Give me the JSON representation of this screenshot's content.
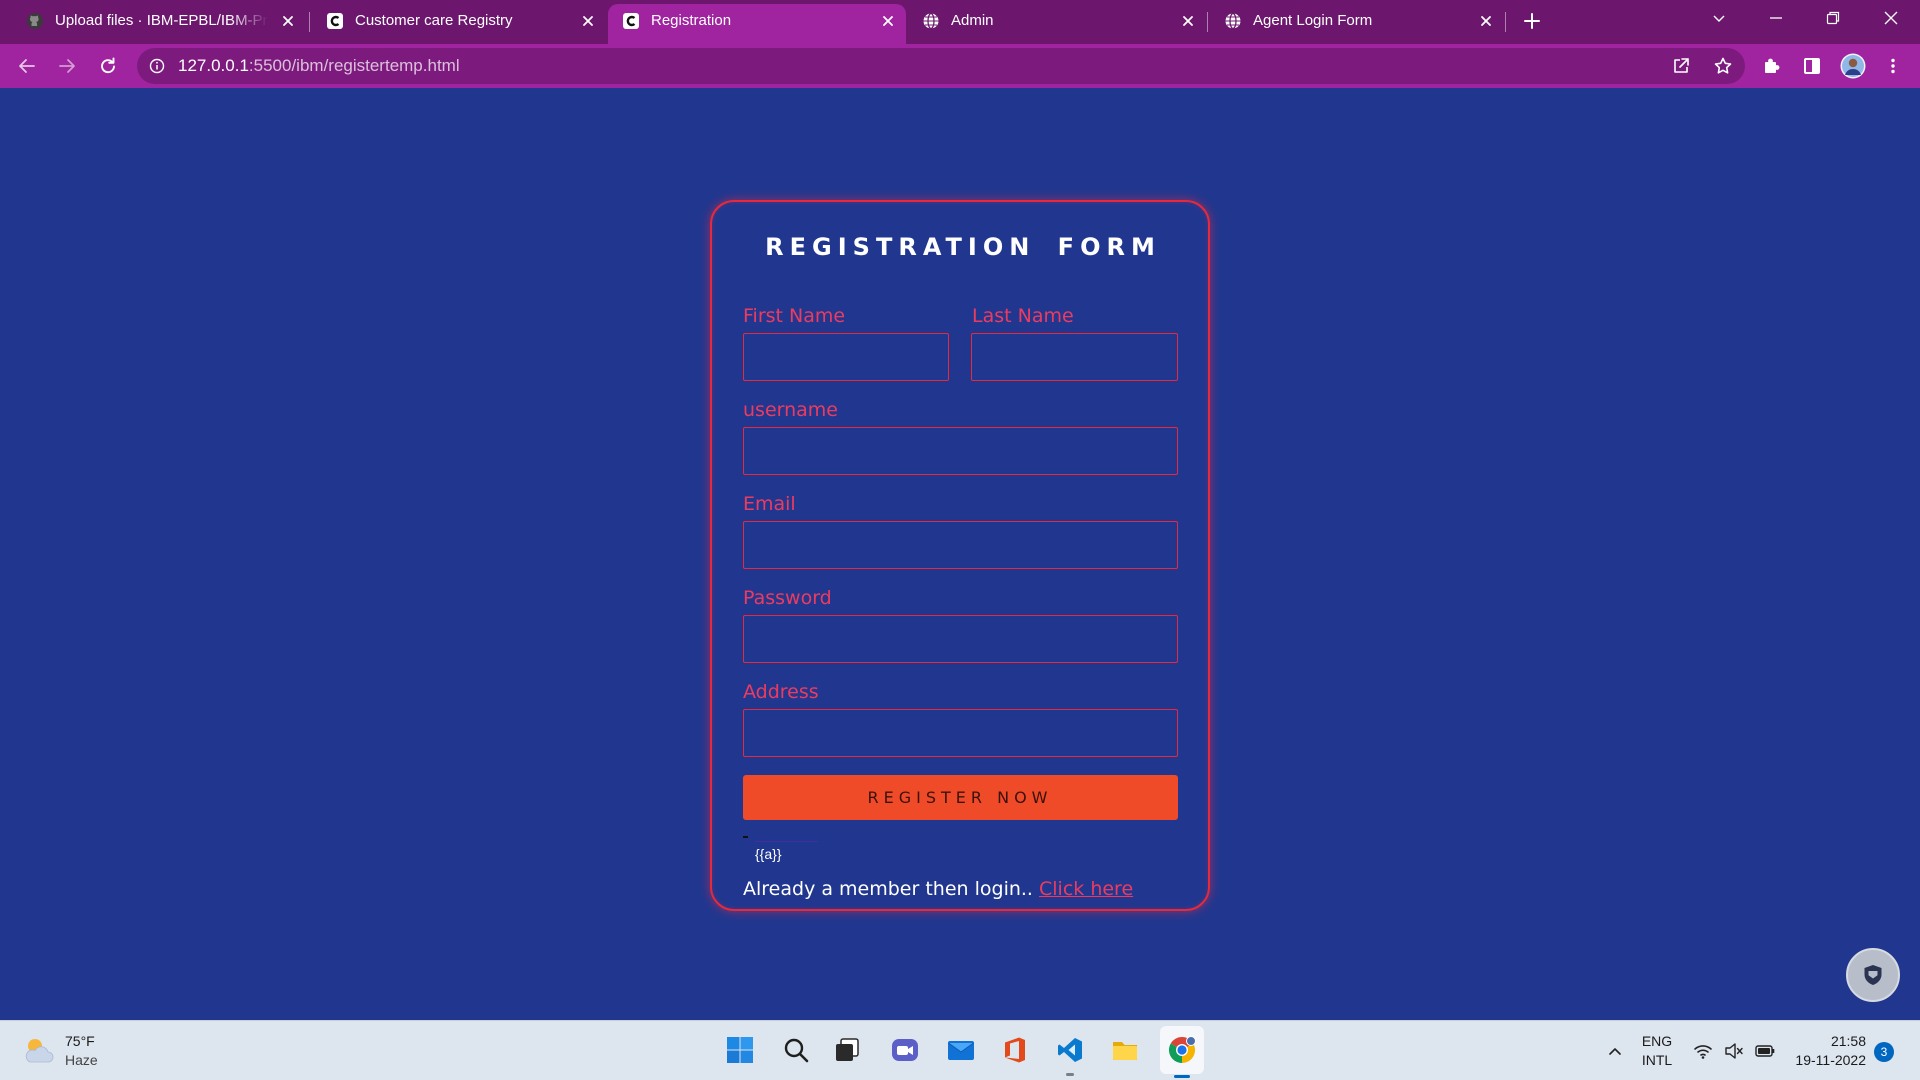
{
  "browser": {
    "tabs": [
      {
        "title": "Upload files · IBM-EPBL/IBM-Proj",
        "icon": "github-icon",
        "active": false
      },
      {
        "title": "Customer care Registry",
        "icon": "app-favicon-icon",
        "active": false
      },
      {
        "title": "Registration",
        "icon": "app-favicon-icon",
        "active": true
      },
      {
        "title": "Admin",
        "icon": "globe-icon",
        "active": false
      },
      {
        "title": "Agent Login Form",
        "icon": "globe-icon",
        "active": false
      }
    ],
    "address": {
      "host": "127.0.0.1",
      "path": ":5500/ibm/registertemp.html"
    }
  },
  "form": {
    "title": "REGISTRATION FORM",
    "fields": {
      "first_name": {
        "label": "First Name",
        "value": ""
      },
      "last_name": {
        "label": "Last Name",
        "value": ""
      },
      "username": {
        "label": "username",
        "value": ""
      },
      "email": {
        "label": "Email",
        "value": ""
      },
      "password": {
        "label": "Password",
        "value": ""
      },
      "address": {
        "label": "Address",
        "value": ""
      }
    },
    "submit_label": "REGISTER NOW",
    "template_placeholder": "{{a}}",
    "login_prompt": "Already a member then login.. ",
    "login_link": "Click here"
  },
  "taskbar": {
    "weather": {
      "temperature": "75°F",
      "condition": "Haze",
      "icon": "weather-haze-icon"
    },
    "apps": [
      "windows-start-icon",
      "search-icon",
      "task-view-icon",
      "chat-icon",
      "mail-icon",
      "office-icon",
      "vscode-icon",
      "file-explorer-icon",
      "chrome-icon"
    ],
    "tray": {
      "language": "ENG",
      "layout": "INTL",
      "time": "21:58",
      "date": "19-11-2022",
      "notification_count": "3"
    }
  },
  "colors": {
    "page_background": "#21378f",
    "tab_strip": "#6c176d",
    "toolbar": "#a0239f",
    "omnibox": "#7d1a7e",
    "accent": "#e62a3e",
    "label": "#ec3b5f",
    "button": "#f04b28",
    "taskbar": "#dde5ef"
  }
}
